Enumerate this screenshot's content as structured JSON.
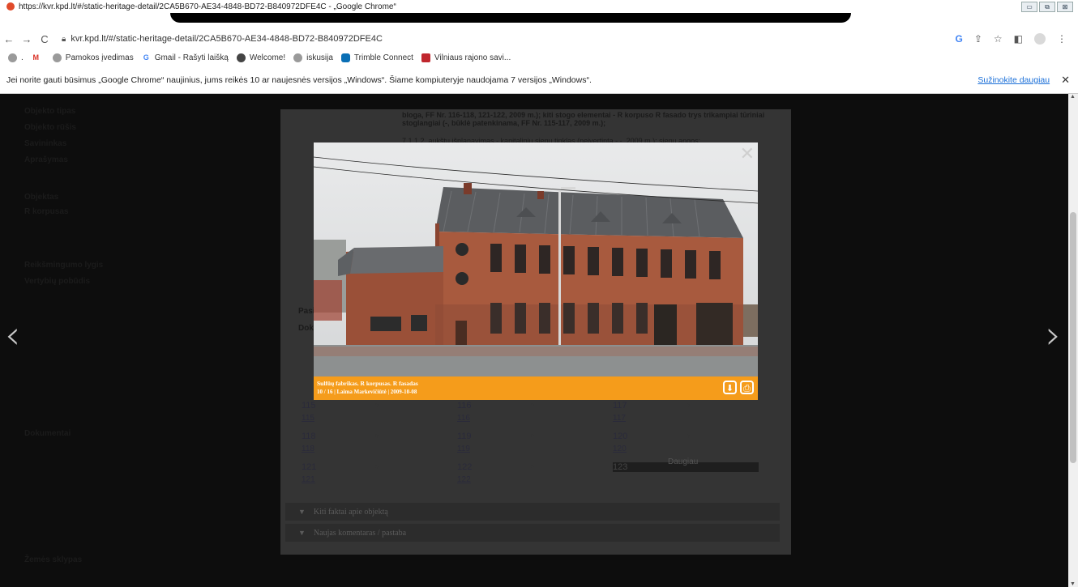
{
  "window": {
    "title": "https://kvr.kpd.lt/#/static-heritage-detail/2CA5B670-AE34-4848-BD72-B840972DFE4C - „Google Chrome“",
    "min": "▭",
    "max": "⧉",
    "close": "⊠"
  },
  "nav": {
    "back": "←",
    "forward": "→",
    "reload": "C",
    "url": "kvr.kpd.lt/#/static-heritage-detail/2CA5B670-AE34-4848-BD72-B840972DFE4C",
    "g": "G",
    "share": "⇪",
    "star": "☆",
    "tabs": "◧",
    "menu": "⋮"
  },
  "bookmarks": {
    "items": [
      {
        "label": "Pamokos įvedimas",
        "color": "#9a9a9a",
        "icon": "globe-icon",
        "glyph": ""
      },
      {
        "label": "Gmail - Rašyti laišką",
        "color": "#ffffff",
        "icon": "google-icon",
        "glyph": "G"
      },
      {
        "label": "Welcome!",
        "color": "#444444",
        "icon": "welcome-icon",
        "glyph": ""
      },
      {
        "label": "iskusija",
        "color": "#9a9a9a",
        "icon": "globe-icon",
        "glyph": ""
      },
      {
        "label": "Trimble Connect",
        "color": "#0a6fb5",
        "icon": "trimble-icon",
        "glyph": ""
      },
      {
        "label": "Vilniaus rajono savi...",
        "color": "#c0262d",
        "icon": "vilnius-icon",
        "glyph": ""
      }
    ],
    "dot": ".",
    "m": "M"
  },
  "infobar": {
    "message": "Jei norite gauti būsimus „Google Chrome“ naujinius, jums reikės 10 ar naujesnės versijos „Windows“. Šiame kompiuteryje naudojama 7 versijos „Windows“.",
    "learn": "Sužinokite daugiau",
    "close": "✕"
  },
  "page": {
    "left_labels": [
      "Objekto tipas",
      "Objekto rūšis",
      "Savininkas",
      "Aprašymas"
    ],
    "left_labels_lower": [
      "Objektas",
      "R korpusas"
    ],
    "left_labels_mid": [
      "Reikšmingumo lygis",
      "Vertybių pobūdis"
    ],
    "left_label_bottom": "Dokumentai",
    "left_label_last": "Žemės sklypas",
    "prev_arrow": "‹",
    "next_arrow": "›"
  },
  "modal": {
    "text_top": "bloga, FF Nr. 116-118, 121-122, 2009 m.); kiti stogo elementai - R korpuso R fasado trys trikampiai tūriniai stoglangiai (-, būklė patenkinama, FF Nr. 115-117, 2009 m.);",
    "text_line2": "7.1.1.2. aukštų išplanavimas - kapitalinių sienų tinklas (neįvertinta - -, 2009 m.); sienų angos;",
    "label_pasi": "Pasi",
    "label_doki": "Doki",
    "thumbs": [
      {
        "alt": "115",
        "link": "115"
      },
      {
        "alt": "116",
        "link": "116"
      },
      {
        "alt": "117",
        "link": "117"
      },
      {
        "alt": "118",
        "link": "118"
      },
      {
        "alt": "119",
        "link": "119"
      },
      {
        "alt": "120",
        "link": "120"
      },
      {
        "alt": "121",
        "link": "121"
      },
      {
        "alt": "122",
        "link": "122"
      },
      {
        "alt": "123",
        "link": ""
      }
    ],
    "thumb_dot": "○",
    "acc1": "Kiti faktai apie objektą",
    "acc2": "Naujas komentaras / pastaba",
    "acc_tri": "▼",
    "extra_label": "Daugiau"
  },
  "lightbox": {
    "title": "Sulfūų fabrikas. R korpusas. R fasadas",
    "meta": "10 / 16 | Laima Markevičiūtė | 2009-10-08",
    "download": "⬇",
    "print": "⎙",
    "close": "✕"
  },
  "colors": {
    "accent": "#f59c1b",
    "overlay": "#0d0d0d",
    "modal": "#343434"
  }
}
